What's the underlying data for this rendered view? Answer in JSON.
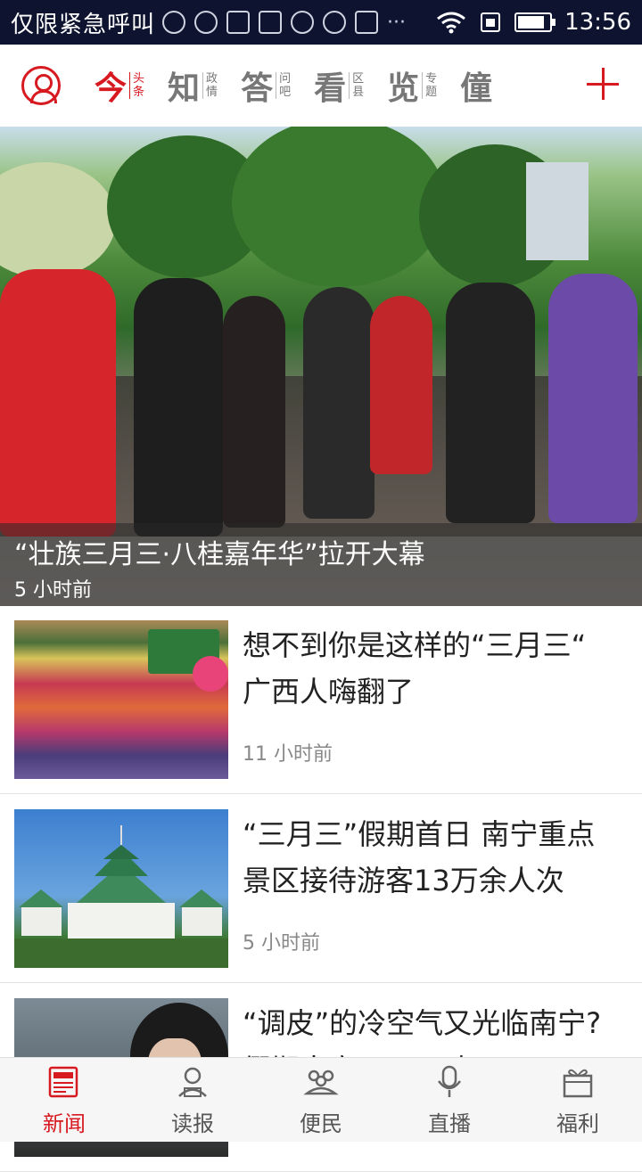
{
  "status_bar": {
    "carrier": "仅限紧急呼叫",
    "time": "13:56",
    "battery_level": 0.85,
    "icons": [
      "loading-icon",
      "headset-icon",
      "battery-saver-icon",
      "image-icon",
      "no-disturb-icon",
      "alert-icon",
      "keyboard-icon",
      "more-icon",
      "wifi-icon",
      "sim-icon",
      "battery-icon"
    ]
  },
  "nav": {
    "tabs": [
      {
        "big": "今",
        "small1": "头",
        "small2": "条",
        "active": true
      },
      {
        "big": "知",
        "small1": "政",
        "small2": "情",
        "active": false
      },
      {
        "big": "答",
        "small1": "问",
        "small2": "吧",
        "active": false
      },
      {
        "big": "看",
        "small1": "区",
        "small2": "县",
        "active": false
      },
      {
        "big": "览",
        "small1": "专",
        "small2": "题",
        "active": false
      },
      {
        "big": "僮",
        "small1": "",
        "small2": "",
        "active": false
      }
    ],
    "accent_color": "#d71920"
  },
  "hero": {
    "title": "“壮族三月三·八桂嘉年华”拉开大幕",
    "time": "5 小时前"
  },
  "articles": [
    {
      "title": "想不到你是这样的“三月三“ 广西人嗨翻了",
      "time": "11 小时前"
    },
    {
      "title": "“三月三”假期首日 南宁重点景区接待游客13万余人次",
      "time": "5 小时前"
    },
    {
      "title": "“调皮”的冷空气又光临南宁?假期南宁又雨又晴",
      "time": ""
    }
  ],
  "tabbar": {
    "items": [
      {
        "label": "新闻",
        "icon": "news-icon",
        "active": true
      },
      {
        "label": "读报",
        "icon": "reader-icon",
        "active": false
      },
      {
        "label": "便民",
        "icon": "community-icon",
        "active": false
      },
      {
        "label": "直播",
        "icon": "microphone-icon",
        "active": false
      },
      {
        "label": "福利",
        "icon": "gift-icon",
        "active": false
      }
    ]
  }
}
